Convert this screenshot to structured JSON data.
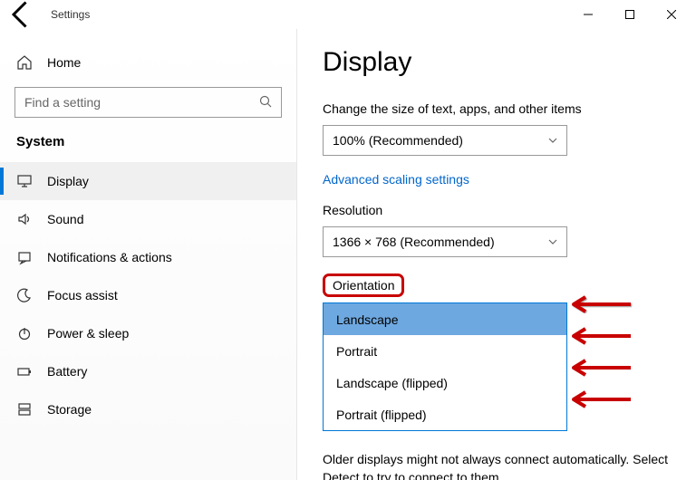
{
  "app_title": "Settings",
  "home_label": "Home",
  "search_placeholder": "Find a setting",
  "category_label": "System",
  "nav": [
    {
      "label": "Display",
      "selected": true,
      "icon": "display"
    },
    {
      "label": "Sound",
      "selected": false,
      "icon": "sound"
    },
    {
      "label": "Notifications & actions",
      "selected": false,
      "icon": "notifications"
    },
    {
      "label": "Focus assist",
      "selected": false,
      "icon": "moon"
    },
    {
      "label": "Power & sleep",
      "selected": false,
      "icon": "power"
    },
    {
      "label": "Battery",
      "selected": false,
      "icon": "battery"
    },
    {
      "label": "Storage",
      "selected": false,
      "icon": "storage"
    }
  ],
  "page_title": "Display",
  "scale_label": "Change the size of text, apps, and other items",
  "scale_value": "100% (Recommended)",
  "advanced_link": "Advanced scaling settings",
  "resolution_label": "Resolution",
  "resolution_value": "1366 × 768 (Recommended)",
  "orientation_label": "Orientation",
  "orientation_options": [
    {
      "label": "Landscape",
      "selected": true
    },
    {
      "label": "Portrait",
      "selected": false
    },
    {
      "label": "Landscape (flipped)",
      "selected": false
    },
    {
      "label": "Portrait (flipped)",
      "selected": false
    }
  ],
  "footer_text": "Older displays might not always connect automatically. Select Detect to try to connect to them."
}
